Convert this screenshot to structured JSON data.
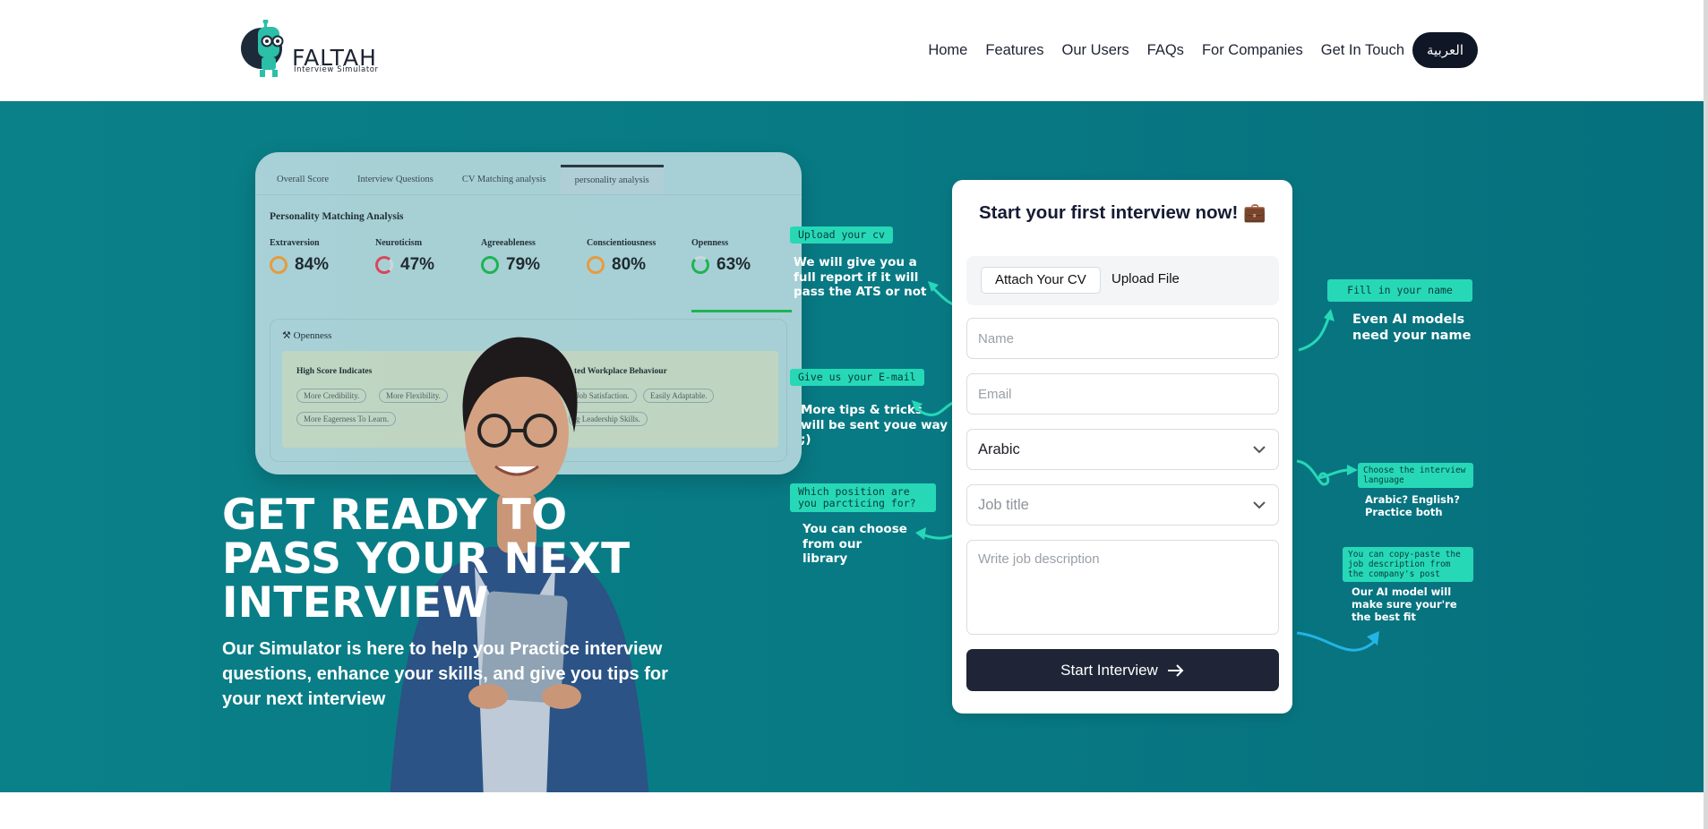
{
  "header": {
    "logo_text": "FALTAH",
    "logo_sub": "Interview Simulator",
    "nav": [
      "Home",
      "Features",
      "Our Users",
      "FAQs",
      "For Companies",
      "Get In Touch"
    ],
    "lang_button": "العربية"
  },
  "dashboard": {
    "tabs": [
      "Overall Score",
      "Interview Questions",
      "CV Matching analysis",
      "personality analysis"
    ],
    "title": "Personality Matching Analysis",
    "metrics": [
      {
        "name": "Extraversion",
        "value": "84%",
        "color": "#e89b3c"
      },
      {
        "name": "Neuroticism",
        "value": "47%",
        "color": "#d9465a"
      },
      {
        "name": "Agreeableness",
        "value": "79%",
        "color": "#1eb453"
      },
      {
        "name": "Conscientiousness",
        "value": "80%",
        "color": "#e89b3c"
      },
      {
        "name": "Openness",
        "value": "63%",
        "color": "#1eb453"
      }
    ],
    "openness_label": "Openness",
    "high_score_title": "High Score Indicates",
    "workplace_title": "ted Workplace Behaviour",
    "pills": [
      "More Credibility.",
      "More Flexibility.",
      "More Eagerness To Learn.",
      "Job Satisfaction.",
      "Easily Adaptable.",
      "g Leadership Skills."
    ]
  },
  "hero": {
    "headline": "GET READY TO PASS YOUR NEXT INTERVIEW",
    "subtext": "Our Simulator is here to help you Practice interview questions, enhance your skills, and give you tips for your next interview"
  },
  "form": {
    "title": "Start your first interview now! 💼",
    "attach_label": "Attach Your CV",
    "upload_label": "Upload File",
    "name_placeholder": "Name",
    "email_placeholder": "Email",
    "language_value": "Arabic",
    "job_title_placeholder": "Job title",
    "description_placeholder": "Write job description",
    "start_button": "Start Interview"
  },
  "annotations": {
    "upload_tag": "Upload your cv",
    "upload_note": "We will give you a full report if it will pass the ATS or not",
    "email_tag": "Give us your E-mail",
    "email_note": "More tips & tricks will be sent youe way ;)",
    "position_tag": "Which position are you parcticing for?",
    "position_note": "You can choose from our library",
    "name_tag": "Fill in your name",
    "name_note": "Even AI models need your name",
    "lang_tag": "Choose the interview language",
    "lang_note": "Arabic? English? Practice both",
    "desc_tag": "You can copy-paste the job description from the company's post",
    "desc_note": "Our AI model will make sure your're the best fit"
  },
  "colors": {
    "hero_bg": "#087a82",
    "accent_tag": "#27d8b7",
    "dark_button": "#1f2536"
  },
  "icons": [
    "robot-logo-icon",
    "chevron-down-icon",
    "arrow-right-icon",
    "openness-icon"
  ]
}
